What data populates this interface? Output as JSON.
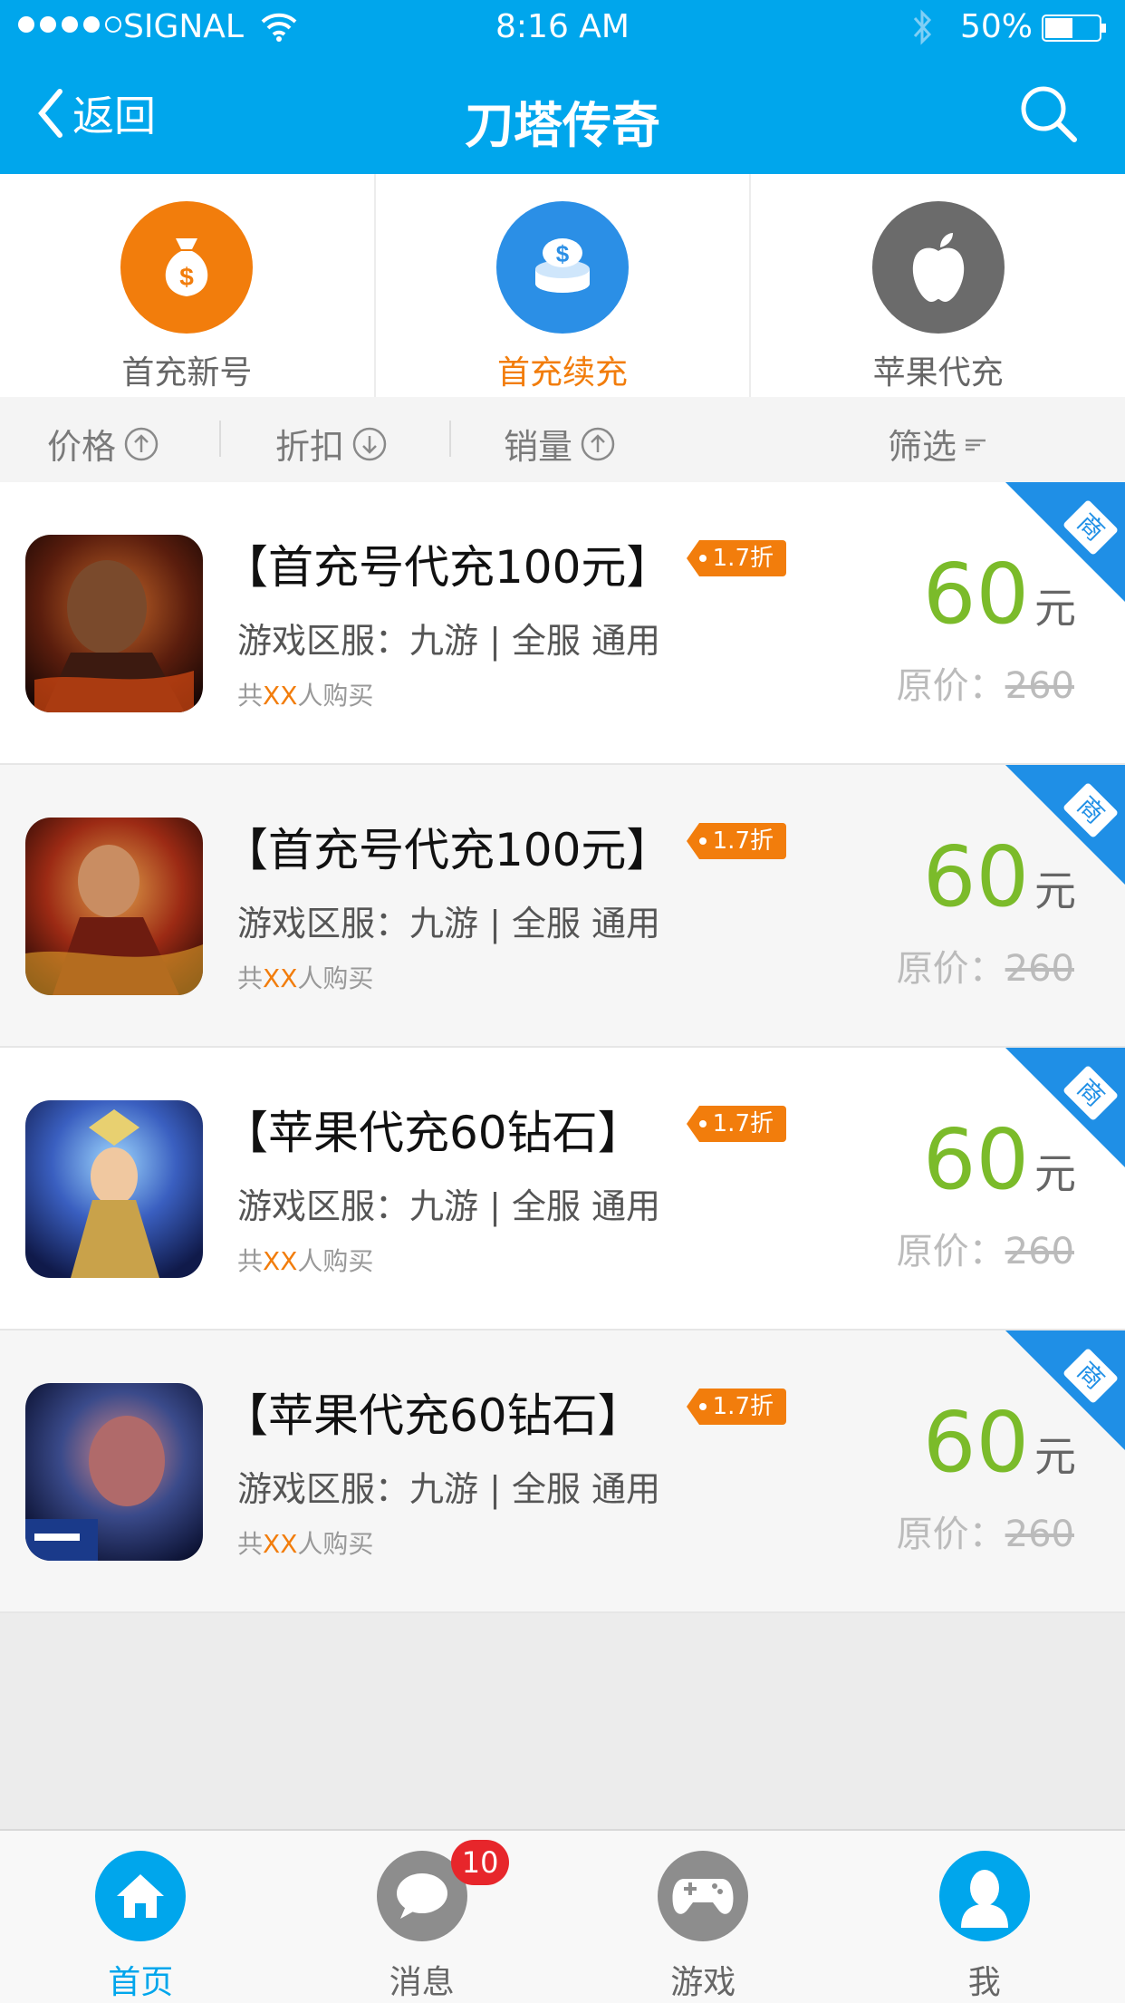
{
  "status_bar": {
    "carrier": "SIGNAL",
    "time": "8:16 AM",
    "battery": "50%"
  },
  "header": {
    "back_label": "返回",
    "title": "刀塔传奇"
  },
  "categories": [
    {
      "label": "首充新号",
      "icon": "money-bag-icon",
      "color": "#f27d0c",
      "active": false
    },
    {
      "label": "首充续充",
      "icon": "coins-icon",
      "color": "#2b8fe6",
      "active": true
    },
    {
      "label": "苹果代充",
      "icon": "apple-icon",
      "color": "#6b6b6b",
      "active": false
    }
  ],
  "sort": [
    {
      "label": "价格",
      "direction": "up"
    },
    {
      "label": "折扣",
      "direction": "down"
    },
    {
      "label": "销量",
      "direction": "up"
    },
    {
      "label": "筛选",
      "direction": "filter"
    }
  ],
  "items": [
    {
      "name": "【首充号代充100元】",
      "discount": "1.7折",
      "server": "游戏区服：九游 | 全服 通用",
      "buyers_prefix": "共",
      "buyers_count": "XX",
      "buyers_suffix": "人购买",
      "price": "60",
      "unit": "元",
      "orig_label": "原价：",
      "orig_price": "260",
      "merchant": "商"
    },
    {
      "name": "【首充号代充100元】",
      "discount": "1.7折",
      "server": "游戏区服：九游 | 全服 通用",
      "buyers_prefix": "共",
      "buyers_count": "XX",
      "buyers_suffix": "人购买",
      "price": "60",
      "unit": "元",
      "orig_label": "原价：",
      "orig_price": "260",
      "merchant": "商"
    },
    {
      "name": "【苹果代充60钻石】",
      "discount": "1.7折",
      "server": "游戏区服：九游 | 全服 通用",
      "buyers_prefix": "共",
      "buyers_count": "XX",
      "buyers_suffix": "人购买",
      "price": "60",
      "unit": "元",
      "orig_label": "原价：",
      "orig_price": "260",
      "merchant": "商"
    },
    {
      "name": "【苹果代充60钻石】",
      "discount": "1.7折",
      "server": "游戏区服：九游 | 全服 通用",
      "buyers_prefix": "共",
      "buyers_count": "XX",
      "buyers_suffix": "人购买",
      "price": "60",
      "unit": "元",
      "orig_label": "原价：",
      "orig_price": "260",
      "merchant": "商"
    }
  ],
  "tabbar": [
    {
      "label": "首页",
      "icon": "home-icon",
      "active": true
    },
    {
      "label": "消息",
      "icon": "chat-bubble-icon",
      "active": false,
      "badge": "10"
    },
    {
      "label": "游戏",
      "icon": "gamepad-icon",
      "active": false
    },
    {
      "label": "我",
      "icon": "user-icon",
      "active": true
    }
  ],
  "colors": {
    "primary": "#00a6ec",
    "accent": "#f27d0c",
    "price": "#7bbb2a",
    "badge": "#e7262b"
  }
}
